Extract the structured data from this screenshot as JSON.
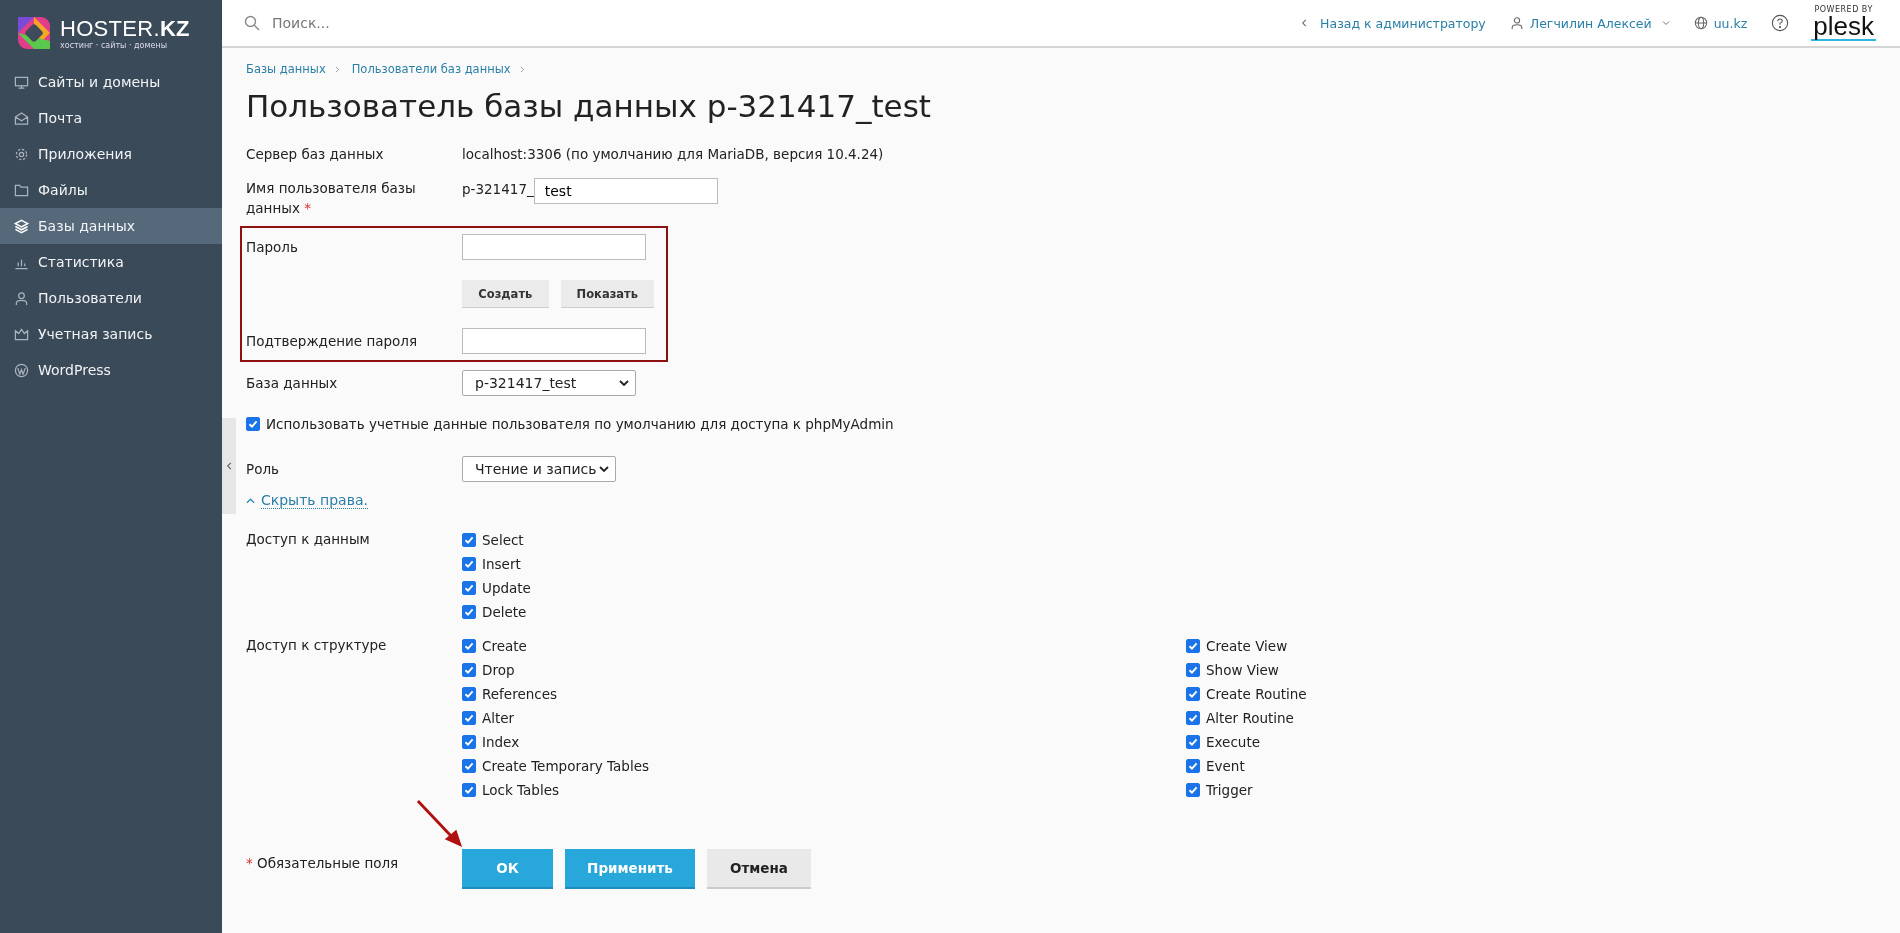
{
  "brand": {
    "name": "HOSTER.**KZ**",
    "tagline": "хостинг · сайты · домены"
  },
  "sidebar": {
    "items": [
      {
        "label": "Сайты и домены",
        "selected": false
      },
      {
        "label": "Почта",
        "selected": false
      },
      {
        "label": "Приложения",
        "selected": false
      },
      {
        "label": "Файлы",
        "selected": false
      },
      {
        "label": "Базы данных",
        "selected": true
      },
      {
        "label": "Статистика",
        "selected": false
      },
      {
        "label": "Пользователи",
        "selected": false
      },
      {
        "label": "Учетная запись",
        "selected": false
      },
      {
        "label": "WordPress",
        "selected": false
      }
    ]
  },
  "search": {
    "placeholder": "Поиск..."
  },
  "topbar": {
    "back": "Назад к администратору",
    "user": "Легчилин Алексей",
    "domain": "uu.kz",
    "powered_by": "POWERED BY",
    "product": "plesk"
  },
  "breadcrumbs": [
    "Базы данных",
    "Пользователи баз данных"
  ],
  "title": "Пользователь базы данных p-321417_test",
  "form": {
    "server": {
      "label": "Сервер баз данных",
      "value": "localhost:3306 (по умолчанию для MariaDB, версия 10.4.24)"
    },
    "username": {
      "label": "Имя пользователя базы данных",
      "required_mark": "*",
      "prefix": "p-321417_",
      "value": "test"
    },
    "password": {
      "label": "Пароль",
      "buttons": [
        "Создать",
        "Показать"
      ]
    },
    "confirm": {
      "label": "Подтверждение пароля"
    },
    "database": {
      "label": "База данных",
      "value": "p-321417_test"
    },
    "phpmyadmin": {
      "label": "Использовать учетные данные пользователя по умолчанию для доступа к phpMyAdmin",
      "checked": true
    },
    "role": {
      "label": "Роль",
      "value": "Чтение и запись"
    },
    "toggle": {
      "label": "Скрыть права.",
      "expanded": true
    },
    "groups": [
      {
        "label": "Доступ к данным",
        "columns": [
          [
            {
              "label": "Select",
              "checked": true
            },
            {
              "label": "Insert",
              "checked": true
            },
            {
              "label": "Update",
              "checked": true
            },
            {
              "label": "Delete",
              "checked": true
            }
          ]
        ]
      },
      {
        "label": "Доступ к структуре",
        "columns": [
          [
            {
              "label": "Create",
              "checked": true
            },
            {
              "label": "Drop",
              "checked": true
            },
            {
              "label": "References",
              "checked": true
            },
            {
              "label": "Alter",
              "checked": true
            },
            {
              "label": "Index",
              "checked": true
            },
            {
              "label": "Create Temporary Tables",
              "checked": true
            },
            {
              "label": "Lock Tables",
              "checked": true
            }
          ],
          [
            {
              "label": "Create View",
              "checked": true
            },
            {
              "label": "Show View",
              "checked": true
            },
            {
              "label": "Create Routine",
              "checked": true
            },
            {
              "label": "Alter Routine",
              "checked": true
            },
            {
              "label": "Execute",
              "checked": true
            },
            {
              "label": "Event",
              "checked": true
            },
            {
              "label": "Trigger",
              "checked": true
            }
          ]
        ]
      }
    ]
  },
  "required_note": {
    "mark": "*",
    "text": "Обязательные поля"
  },
  "actions": [
    {
      "label": "ОК",
      "kind": "primary"
    },
    {
      "label": "Применить",
      "kind": "primary"
    },
    {
      "label": "Отмена",
      "kind": "secondary"
    }
  ]
}
